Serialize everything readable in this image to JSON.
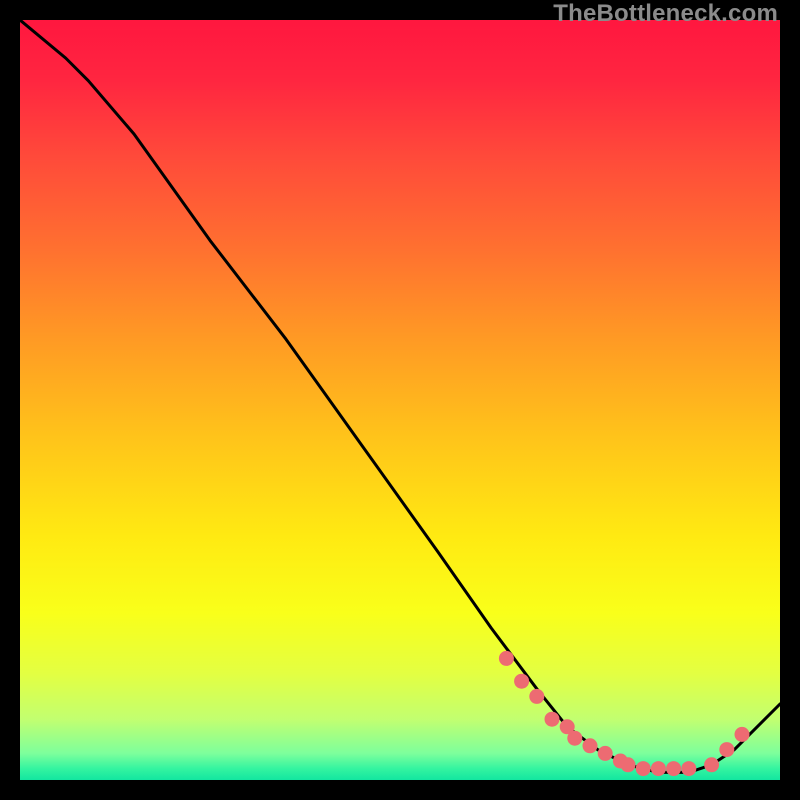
{
  "watermark": "TheBottleneck.com",
  "gradient": {
    "stops": [
      {
        "offset": 0.0,
        "color": "#ff173f"
      },
      {
        "offset": 0.08,
        "color": "#ff2640"
      },
      {
        "offset": 0.18,
        "color": "#ff4a3a"
      },
      {
        "offset": 0.3,
        "color": "#ff7030"
      },
      {
        "offset": 0.42,
        "color": "#ff9a24"
      },
      {
        "offset": 0.55,
        "color": "#ffc41a"
      },
      {
        "offset": 0.68,
        "color": "#ffea12"
      },
      {
        "offset": 0.78,
        "color": "#f9ff1a"
      },
      {
        "offset": 0.86,
        "color": "#e3ff42"
      },
      {
        "offset": 0.92,
        "color": "#c2ff70"
      },
      {
        "offset": 0.965,
        "color": "#7dff9c"
      },
      {
        "offset": 0.985,
        "color": "#34f4a0"
      },
      {
        "offset": 1.0,
        "color": "#12e6a0"
      }
    ]
  },
  "chart_data": {
    "type": "line",
    "title": "",
    "xlabel": "",
    "ylabel": "",
    "xlim": [
      0,
      100
    ],
    "ylim": [
      0,
      100
    ],
    "series": [
      {
        "name": "curve",
        "x": [
          0,
          6,
          9,
          15,
          25,
          35,
          45,
          55,
          62,
          68,
          72,
          76,
          80,
          84,
          88,
          91,
          94,
          97,
          100
        ],
        "values": [
          100,
          95,
          92,
          85,
          71,
          58,
          44,
          30,
          20,
          12,
          7,
          4,
          2,
          1,
          1,
          2,
          4,
          7,
          10
        ]
      }
    ],
    "marker_points": {
      "name": "highlight",
      "x": [
        64,
        66,
        68,
        70,
        72,
        73,
        75,
        77,
        79,
        80,
        82,
        84,
        86,
        88,
        91,
        93,
        95
      ],
      "values": [
        16.0,
        13.0,
        11.0,
        8.0,
        7.0,
        5.5,
        4.5,
        3.5,
        2.5,
        2.0,
        1.5,
        1.5,
        1.5,
        1.5,
        2.0,
        4.0,
        6.0
      ]
    }
  }
}
